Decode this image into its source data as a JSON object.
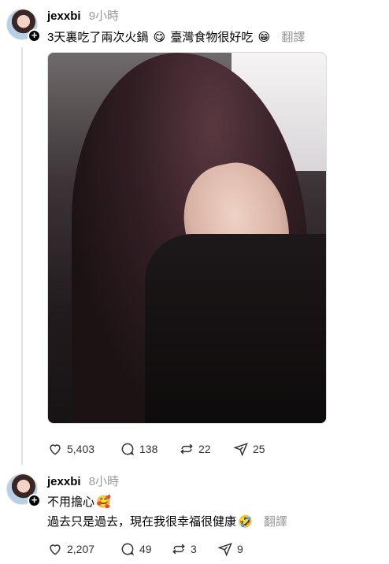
{
  "posts": [
    {
      "username": "jexxbi",
      "time": "9小時",
      "text_before": "3天裏吃了兩次火鍋",
      "emoji1": "😋",
      "text_middle": "臺灣食物很好吃",
      "emoji2": "😁",
      "translate": "翻譯",
      "follow_symbol": "+",
      "likes": "5,403",
      "comments": "138",
      "reposts": "22",
      "shares": "25"
    },
    {
      "username": "jexxbi",
      "time": "8小時",
      "line1": "不用擔心",
      "emoji1": "🥰",
      "line2": "過去只是過去，現在我很幸福很健康",
      "emoji2": "🤣",
      "translate": "翻譯",
      "follow_symbol": "+",
      "likes": "2,207",
      "comments": "49",
      "reposts": "3",
      "shares": "9"
    }
  ],
  "icons": {
    "like": "heart-icon",
    "comment": "comment-icon",
    "repost": "repost-icon",
    "share": "share-icon"
  }
}
